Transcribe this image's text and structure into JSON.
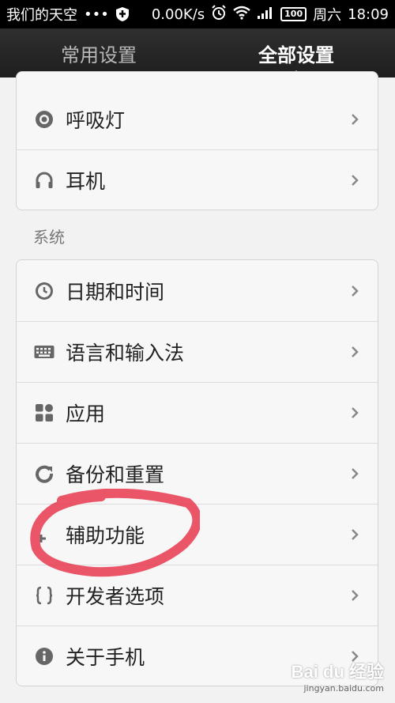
{
  "status_bar": {
    "carrier": "我们的天空",
    "dots": "•••",
    "speed": "0.00K/s",
    "battery": "100",
    "day": "周六",
    "time": "18:09"
  },
  "tabs": [
    {
      "label": "常用设置",
      "active": false
    },
    {
      "label": "全部设置",
      "active": true
    }
  ],
  "top_group": {
    "items": [
      {
        "label": "呼吸灯",
        "icon": "breathing-light-icon"
      },
      {
        "label": "耳机",
        "icon": "headphones-icon"
      }
    ]
  },
  "system_section": {
    "title": "系统",
    "items": [
      {
        "label": "日期和时间",
        "icon": "clock-icon"
      },
      {
        "label": "语言和输入法",
        "icon": "keyboard-icon"
      },
      {
        "label": "应用",
        "icon": "apps-icon"
      },
      {
        "label": "备份和重置",
        "icon": "backup-icon"
      },
      {
        "label": "辅助功能",
        "icon": "accessibility-icon"
      },
      {
        "label": "开发者选项",
        "icon": "developer-icon"
      },
      {
        "label": "关于手机",
        "icon": "info-icon"
      }
    ]
  },
  "watermark": {
    "logo": "Bai du 经验",
    "url": "jingyan.baidu.com"
  },
  "colors": {
    "annotation": "#e8384f",
    "header_bg": "#262626",
    "icon": "#666666"
  }
}
